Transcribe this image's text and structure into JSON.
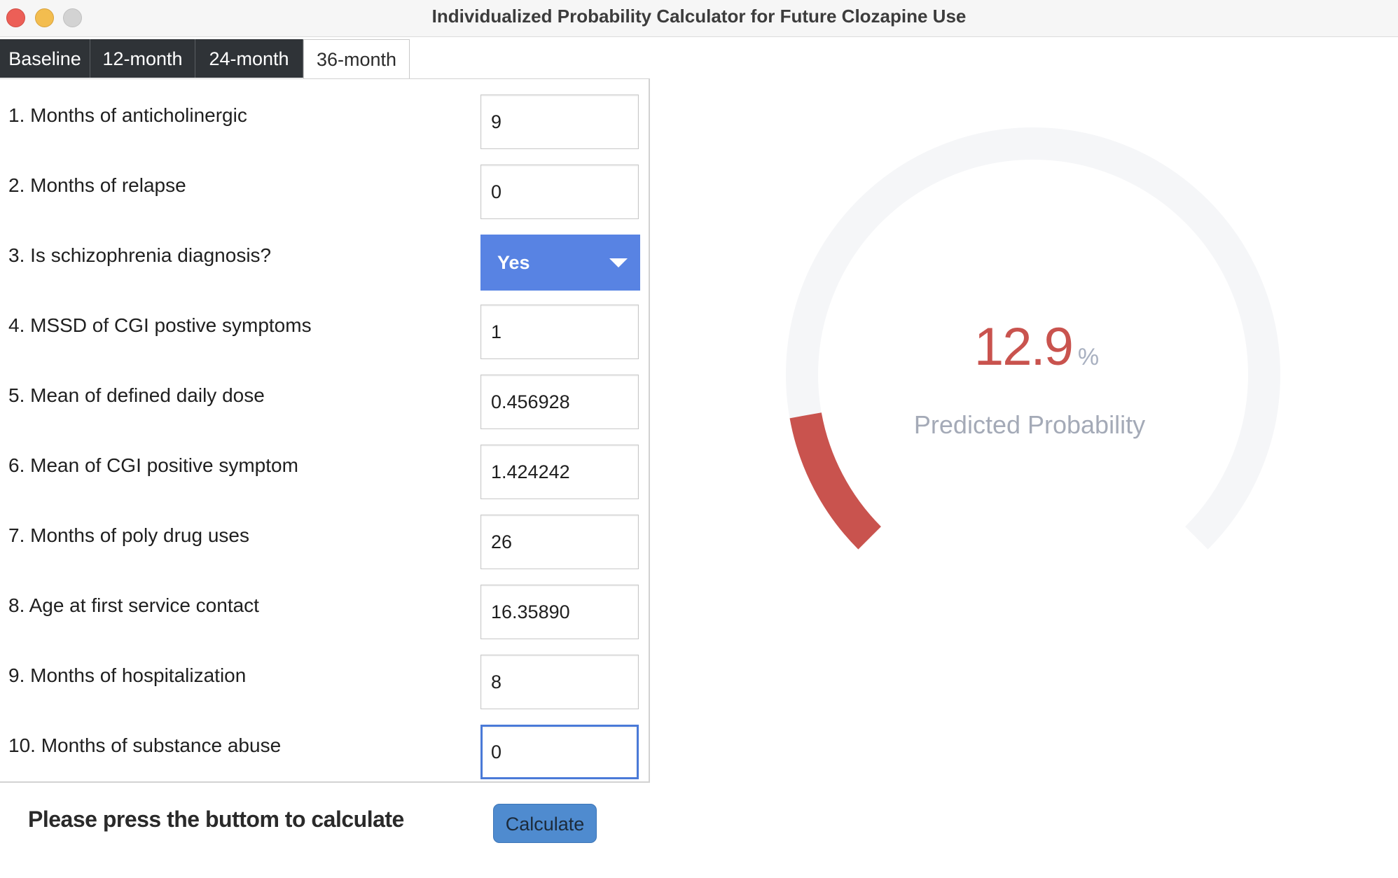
{
  "window": {
    "title": "Individualized Probability Calculator for Future Clozapine Use"
  },
  "tabs": [
    {
      "label": "Baseline",
      "active": false
    },
    {
      "label": "12-month",
      "active": false
    },
    {
      "label": "24-month",
      "active": false
    },
    {
      "label": "36-month",
      "active": true
    }
  ],
  "form": {
    "fields": [
      {
        "label": "1. Months of anticholinergic",
        "value": "9"
      },
      {
        "label": "2. Months of relapse",
        "value": "0"
      },
      {
        "label": "3. Is schizophrenia diagnosis?",
        "value": "Yes"
      },
      {
        "label": "4. MSSD of CGI postive symptoms",
        "value": "1"
      },
      {
        "label": "5. Mean of defined daily dose",
        "value": "0.456928"
      },
      {
        "label": "6. Mean of CGI positive symptom",
        "value": "1.424242"
      },
      {
        "label": "7. Months of poly drug uses",
        "value": "26"
      },
      {
        "label": "8. Age at first service contact",
        "value": "16.35890"
      },
      {
        "label": "9. Months of hospitalization",
        "value": "8"
      },
      {
        "label": "10. Months of substance abuse",
        "value": "0"
      }
    ]
  },
  "footer": {
    "prompt": "Please press the buttom to calculate",
    "calculate_label": "Calculate"
  },
  "gauge": {
    "value": "12.9",
    "unit": "%",
    "label": "Predicted Probability",
    "fraction": 0.129,
    "colors": {
      "fill": "#c9534e",
      "track": "#f5f6f8"
    }
  },
  "icons": {
    "dropdown": "chevron-down-icon"
  }
}
